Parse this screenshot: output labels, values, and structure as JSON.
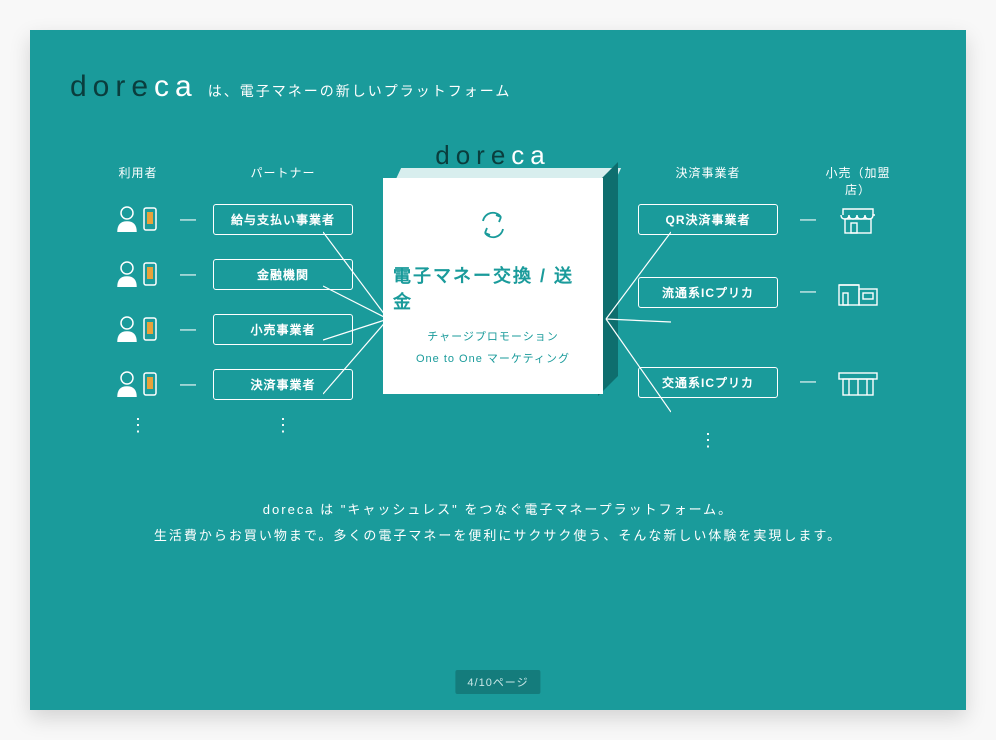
{
  "brand": {
    "dore": "dore",
    "ca": "ca"
  },
  "header_tagline": "は、電子マネーの新しいプラットフォーム",
  "columns": {
    "users_label": "利用者",
    "partners_label": "パートナー",
    "providers_label": "決済事業者",
    "retail_label": "小売（加盟店）"
  },
  "partners": [
    "給与支払い事業者",
    "金融機関",
    "小売事業者",
    "決済事業者"
  ],
  "providers": [
    "QR決済事業者",
    "流通系ICプリカ",
    "交通系ICプリカ"
  ],
  "center": {
    "logo_dore": "dore",
    "logo_ca": "ca",
    "title": "電子マネー交換 / 送金",
    "sub1": "チャージプロモーション",
    "sub2": "One to One マーケティング"
  },
  "footer": {
    "line1": "doreca は \"キャッシュレス\" をつなぐ電子マネープラットフォーム。",
    "line2": "生活費からお買い物まで。多くの電子マネーを便利にサクサク使う、そんな新しい体験を実現します。"
  },
  "page_indicator": "4/10ページ",
  "ellipsis": "⋮",
  "dash": "—"
}
